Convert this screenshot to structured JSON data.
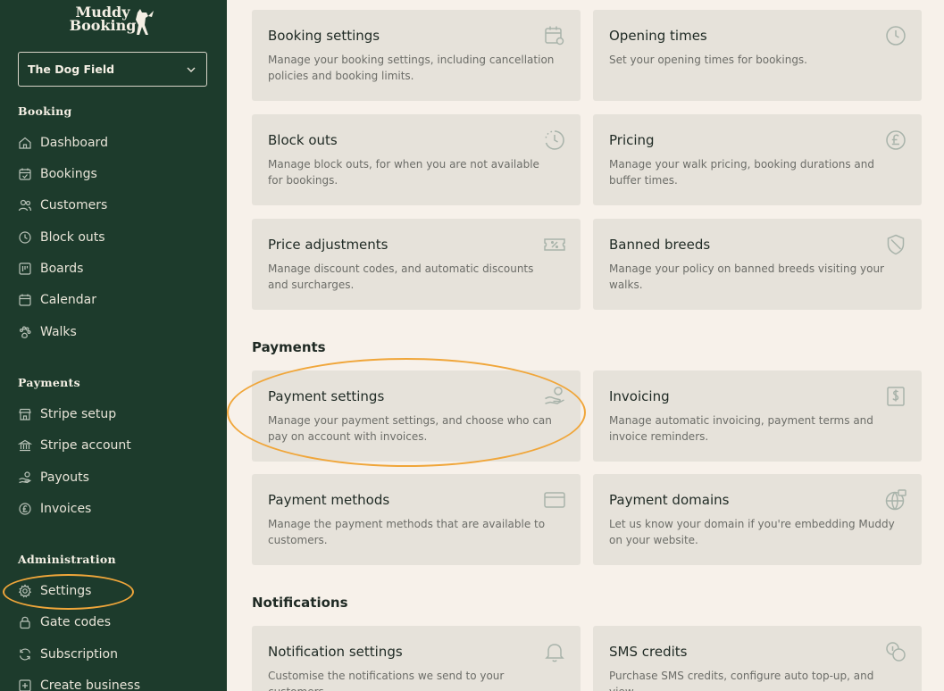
{
  "brand": {
    "line1": "Muddy",
    "line2": "Booking"
  },
  "business_select": {
    "value": "The Dog Field"
  },
  "nav": {
    "booking_heading": "Booking",
    "booking_items": [
      "Dashboard",
      "Bookings",
      "Customers",
      "Block outs",
      "Boards",
      "Calendar",
      "Walks"
    ],
    "payments_heading": "Payments",
    "payments_items": [
      "Stripe setup",
      "Stripe account",
      "Payouts",
      "Invoices"
    ],
    "admin_heading": "Administration",
    "admin_items": [
      "Settings",
      "Gate codes",
      "Subscription",
      "Create business"
    ]
  },
  "sections": {
    "payments": "Payments",
    "notifications": "Notifications"
  },
  "cards": {
    "booking_settings": {
      "title": "Booking settings",
      "desc": "Manage your booking settings, including cancellation policies and booking limits."
    },
    "opening_times": {
      "title": "Opening times",
      "desc": "Set your opening times for bookings."
    },
    "block_outs": {
      "title": "Block outs",
      "desc": "Manage block outs, for when you are not available for bookings."
    },
    "pricing": {
      "title": "Pricing",
      "desc": "Manage your walk pricing, booking durations and buffer times."
    },
    "price_adjustments": {
      "title": "Price adjustments",
      "desc": "Manage discount codes, and automatic discounts and surcharges."
    },
    "banned_breeds": {
      "title": "Banned breeds",
      "desc": "Manage your policy on banned breeds visiting your walks."
    },
    "payment_settings": {
      "title": "Payment settings",
      "desc": "Manage your payment settings, and choose who can pay on account with invoices."
    },
    "invoicing": {
      "title": "Invoicing",
      "desc": "Manage automatic invoicing, payment terms and invoice reminders."
    },
    "payment_methods": {
      "title": "Payment methods",
      "desc": "Manage the payment methods that are available to customers."
    },
    "payment_domains": {
      "title": "Payment domains",
      "desc": "Let us know your domain if you're embedding Muddy on your website."
    },
    "notification_settings": {
      "title": "Notification settings",
      "desc": "Customise the notifications we send to your customers"
    },
    "sms_credits": {
      "title": "SMS credits",
      "desc": "Purchase SMS credits, configure auto top-up, and view"
    }
  },
  "colors": {
    "sidebar": "#1d3b2c",
    "background": "#f7f1ea",
    "card": "#e6e2da",
    "highlight": "#f0a63a",
    "icon": "#a8b3aa"
  }
}
